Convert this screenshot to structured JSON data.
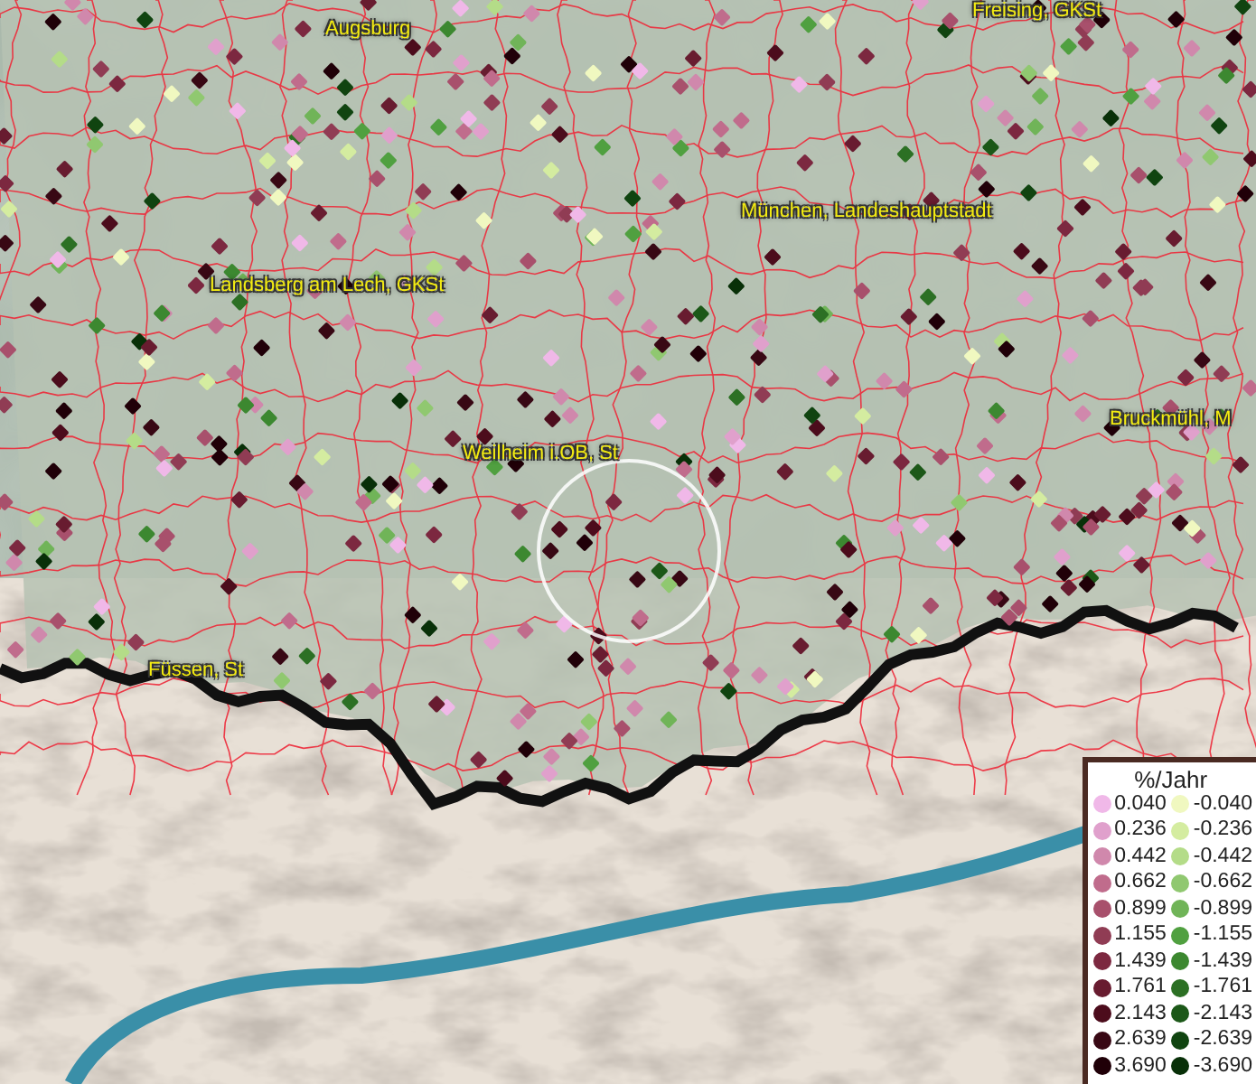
{
  "map": {
    "place_labels": [
      {
        "text": "Freising, GKSt"
      },
      {
        "text": "Augsburg"
      },
      {
        "text": "München, Landeshauptstadt"
      },
      {
        "text": "Landsberg am Lech, GKSt"
      },
      {
        "text": "Weilheim i.OB, St"
      },
      {
        "text": "Bruckmühl, M"
      },
      {
        "text": "Füssen, St"
      }
    ]
  },
  "legend": {
    "title": "%/Jahr",
    "positive": [
      {
        "label": "0.040",
        "color": "#f0b8e8"
      },
      {
        "label": "0.236",
        "color": "#e0a0cc"
      },
      {
        "label": "0.442",
        "color": "#d088ac"
      },
      {
        "label": "0.662",
        "color": "#c06c8c"
      },
      {
        "label": "0.899",
        "color": "#a8506c"
      },
      {
        "label": "1.155",
        "color": "#903c54"
      },
      {
        "label": "1.439",
        "color": "#7c2840"
      },
      {
        "label": "1.761",
        "color": "#681c30"
      },
      {
        "label": "2.143",
        "color": "#4c0c1c"
      },
      {
        "label": "2.639",
        "color": "#380814"
      },
      {
        "label": "3.690",
        "color": "#200008"
      }
    ],
    "negative": [
      {
        "label": "-0.040",
        "color": "#f0f8c0"
      },
      {
        "label": "-0.236",
        "color": "#d4eca0"
      },
      {
        "label": "-0.442",
        "color": "#b4dc88"
      },
      {
        "label": "-0.662",
        "color": "#90c870"
      },
      {
        "label": "-0.899",
        "color": "#70b458"
      },
      {
        "label": "-1.155",
        "color": "#50a040"
      },
      {
        "label": "-1.439",
        "color": "#3c8830"
      },
      {
        "label": "-1.761",
        "color": "#2c7024"
      },
      {
        "label": "-2.143",
        "color": "#1c5818"
      },
      {
        "label": "-2.639",
        "color": "#104410"
      },
      {
        "label": "-3.690",
        "color": "#083008"
      }
    ]
  }
}
